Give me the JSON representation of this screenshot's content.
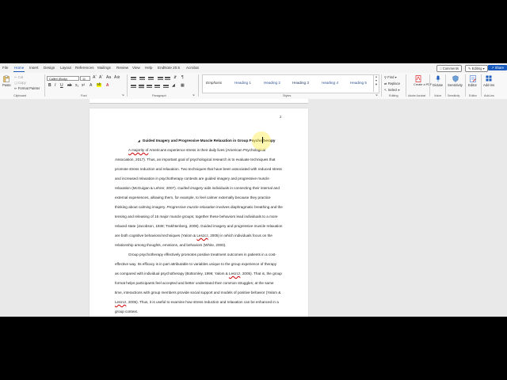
{
  "tabs": [
    "File",
    "Home",
    "Insert",
    "Design",
    "Layout",
    "References",
    "Mailings",
    "Review",
    "View",
    "Help",
    "EndNote 20.5",
    "Acrobat"
  ],
  "active_tab": "Home",
  "top_right": {
    "comments": "Comments",
    "editing": "Editing",
    "share": "Share"
  },
  "ribbon": {
    "clipboard": {
      "paste": "Paste",
      "cut": "Cut",
      "copy": "Copy",
      "format_painter": "Format Painter",
      "label": "Clipboard"
    },
    "font": {
      "name": "Calibri (Body)",
      "size": "11",
      "label": "Font"
    },
    "paragraph": {
      "label": "Paragraph"
    },
    "styles": {
      "items": [
        "Emphasis",
        "Heading 1",
        "Heading 2",
        "Heading 3",
        "Heading 4",
        "Heading 5"
      ],
      "label": "Styles"
    },
    "editing": {
      "find": "Find",
      "replace": "Replace",
      "select": "Select",
      "label": "Editing"
    },
    "acrobat": {
      "create": "Create a PDF",
      "label": "Adobe Acrobat"
    },
    "voice": {
      "dictate": "Dictate",
      "label": "Voice"
    },
    "sensitivity": {
      "name": "Sensitivity",
      "label": "Sensitivity"
    },
    "editor": {
      "name": "Editor",
      "label": "Editor"
    },
    "addins": {
      "name": "Add-ins",
      "label": "Add-ins"
    }
  },
  "document": {
    "page_number": "2",
    "heading": "Guided Imagery and Progressive Muscle Relaxation in Group Psychotherapy",
    "para1": [
      "A majority of Americans experience stress in their daily lives (American Psychological",
      "Association, 2017). Thus, an important goal of psychological research is to evaluate techniques that",
      "promote stress reduction and relaxation. Two techniques that have been associated with reduced stress",
      "and increased relaxation in psychotherapy contexts are guided imagery and progressive muscle",
      "relaxation (McGuigan & Lehrer, 2007). Guided imagery aids individuals in connecting their internal and",
      "external experiences, allowing them, for example, to feel calmer externally because they practice",
      "thinking about calming imagery. Progressive muscle relaxation involves diaphragmatic breathing and the",
      "tensing and releasing of 16 major muscle groups; together these behaviors lead individuals to a more",
      "relaxed state (Jacobson, 1938; Trakhtenberg, 2008). Guided imagery and progressive muscle relaxation",
      "are both cognitive behavioral techniques (Yalom & Leszcz, 2005) in which individuals focus on the",
      "relationship among thoughts, emotions, and behaviors (White, 2000)."
    ],
    "para2": [
      "Group psychotherapy effectively promotes positive treatment outcomes in patients in a cost-",
      "effective way. Its efficacy is in part attributable to variables unique to the group experience of therapy",
      "as compared with individual psychotherapy (Bottomley, 1996; Yalom & Leszcz, 2005). That is, the group",
      "format helps participants feel accepted and better understand their common struggles; at the same",
      "time, interactions with group members provide social support and models of positive behavior (Yalom &",
      "Leszcz, 2005). Thus, it is useful to examine how stress reduction and relaxation can be enhanced in a",
      "group context."
    ]
  }
}
